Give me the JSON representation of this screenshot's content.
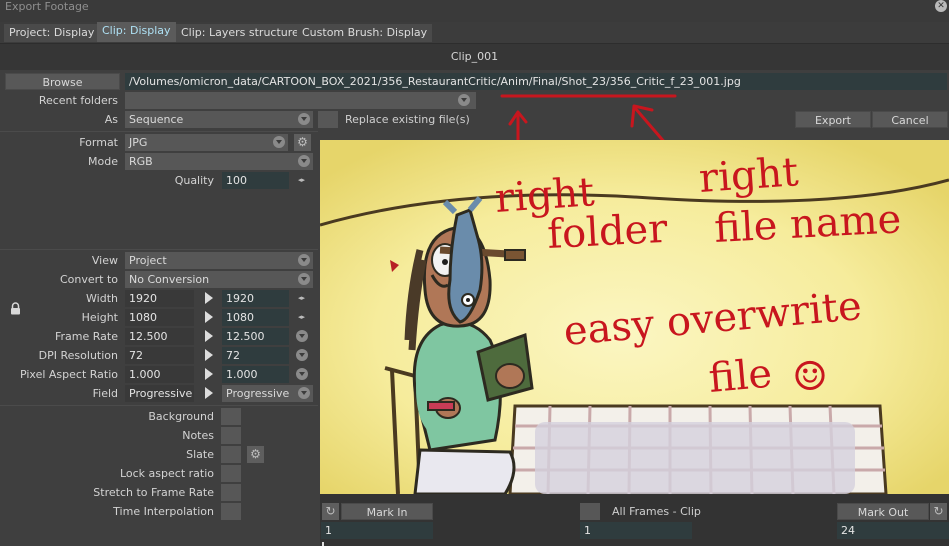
{
  "window": {
    "title": "Export Footage"
  },
  "tabs": [
    {
      "label": "Project: Display"
    },
    {
      "label": "Clip: Display"
    },
    {
      "label": "Clip: Layers structure"
    },
    {
      "label": "Custom Brush: Display"
    }
  ],
  "clip_name": "Clip_001",
  "browse": {
    "button_label": "Browse",
    "path": "/Volumes/omicron_data/CARTOON_BOX_2021/356_RestaurantCritic/Anim/Final/Shot_23/356_Critic_f_23_001.jpg"
  },
  "recent_folders": {
    "label": "Recent folders",
    "value": ""
  },
  "as": {
    "label": "As",
    "value": "Sequence"
  },
  "replace": {
    "label": "Replace existing file(s)",
    "checked": false
  },
  "actions": {
    "export": "Export",
    "cancel": "Cancel"
  },
  "format": {
    "label": "Format",
    "value": "JPG"
  },
  "mode": {
    "label": "Mode",
    "value": "RGB"
  },
  "quality": {
    "label": "Quality",
    "value": "100"
  },
  "view": {
    "label": "View",
    "value": "Project"
  },
  "convert_to": {
    "label": "Convert to",
    "value": "No Conversion"
  },
  "width": {
    "label": "Width",
    "source": "1920",
    "target": "1920"
  },
  "height": {
    "label": "Height",
    "source": "1080",
    "target": "1080"
  },
  "frame_rate": {
    "label": "Frame Rate",
    "source": "12.500",
    "target": "12.500"
  },
  "dpi": {
    "label": "DPI Resolution",
    "source": "72",
    "target": "72"
  },
  "pixel_aspect": {
    "label": "Pixel Aspect Ratio",
    "source": "1.000",
    "target": "1.000"
  },
  "field": {
    "label": "Field",
    "source": "Progressive",
    "target": "Progressive"
  },
  "checks": [
    {
      "label": "Background"
    },
    {
      "label": "Notes"
    },
    {
      "label": "Slate"
    },
    {
      "label": "Lock aspect ratio"
    },
    {
      "label": "Stretch to Frame Rate"
    },
    {
      "label": "Time Interpolation"
    }
  ],
  "annotations": {
    "right1": "right",
    "folder": "folder",
    "right2": "right",
    "file_name": "file name",
    "easy": "easy overwrite",
    "file": "file",
    "smiley": "☺"
  },
  "timeline": {
    "mark_in": "Mark In",
    "mark_in_value": "1",
    "frames_label": "All Frames - Clip",
    "frames_value": "1",
    "mark_out": "Mark Out",
    "mark_out_value": "24"
  },
  "colors": {
    "accent_tab": "#aee0f3",
    "annotation_red": "#c8161e",
    "preview_bg": "#f2e58e"
  }
}
